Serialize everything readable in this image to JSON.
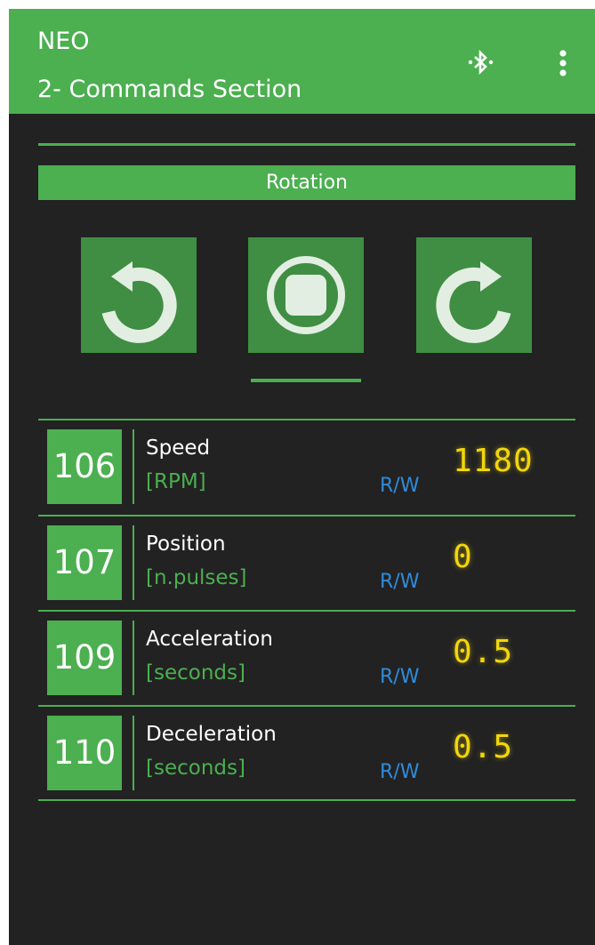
{
  "app": {
    "title": "NEO",
    "subtitle": "2- Commands Section",
    "colors": {
      "accent": "#4caf50",
      "background": "#222222",
      "display": "#f2d60b",
      "rw": "#2f8bdc"
    }
  },
  "toolbar": {
    "bluetooth_icon": "bluetooth-icon",
    "menu_icon": "more-vert-icon"
  },
  "rotation": {
    "label": "Rotation",
    "buttons": [
      {
        "name": "rotate-counterclockwise",
        "icon": "rotate-ccw-icon"
      },
      {
        "name": "stop",
        "icon": "stop-icon"
      },
      {
        "name": "rotate-clockwise",
        "icon": "rotate-cw-icon"
      }
    ]
  },
  "params": [
    {
      "address": "106",
      "name": "Speed",
      "unit": "[RPM]",
      "access": "R/W",
      "value": "1180"
    },
    {
      "address": "107",
      "name": "Position",
      "unit": "[n.pulses]",
      "access": "R/W",
      "value": "0"
    },
    {
      "address": "109",
      "name": "Acceleration",
      "unit": "[seconds]",
      "access": "R/W",
      "value": "0.5"
    },
    {
      "address": "110",
      "name": "Deceleration",
      "unit": "[seconds]",
      "access": "R/W",
      "value": "0.5"
    }
  ]
}
